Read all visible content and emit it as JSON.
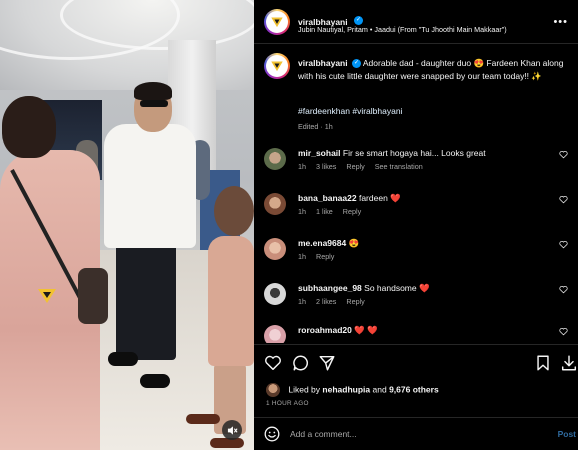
{
  "post": {
    "username": "viralbhayani",
    "verified_glyph": "✓",
    "music": "Jubin Nautiyal, Pritam • Jaadui (From \"Tu Jhoothi Main Makkaar\")",
    "more_icon": "more-horizontal-icon",
    "caption_author": "viralbhayani",
    "caption_text": "Adorable dad - daughter duo 😍 Fardeen Khan along with his cute little daughter were snapped by our team today!! ✨",
    "hashtags": "#fardeenkhan #viralbhayani",
    "edited": "Edited · 1h"
  },
  "comments": [
    {
      "username": "mir_sohail",
      "text": "Fir se smart hogaya hai... Looks great",
      "time": "1h",
      "likes": "3 likes",
      "reply": "Reply",
      "extra": "See translation",
      "avatar_color": "#5c6b4a"
    },
    {
      "username": "bana_banaa22",
      "text": "fardeen ❤️",
      "time": "1h",
      "likes": "1 like",
      "reply": "Reply",
      "extra": "",
      "avatar_color": "#7a4a35"
    },
    {
      "username": "me.ena9684",
      "text": "😍",
      "time": "1h",
      "likes": "",
      "reply": "Reply",
      "extra": "",
      "avatar_color": "#c98e7a"
    },
    {
      "username": "subhaangee_98",
      "text": "So handsome ❤️",
      "time": "1h",
      "likes": "2 likes",
      "reply": "Reply",
      "extra": "",
      "avatar_color": "#d8d8d8"
    },
    {
      "username": "roroahmad20",
      "text": "❤️ ❤️",
      "time": "",
      "likes": "",
      "reply": "",
      "extra": "",
      "avatar_color": "#d9a0a8"
    }
  ],
  "actions": {
    "liked_by_prefix": "Liked by",
    "liked_by_user": "nehadhupia",
    "liked_by_and": "and",
    "liked_by_others": "9,676 others",
    "time_ago": "1 HOUR AGO",
    "comment_placeholder": "Add a comment...",
    "post_label": "Post"
  },
  "colors": {
    "accent": "#0095f6",
    "heart": "#ff3040",
    "muted": "#a8a8a8"
  }
}
